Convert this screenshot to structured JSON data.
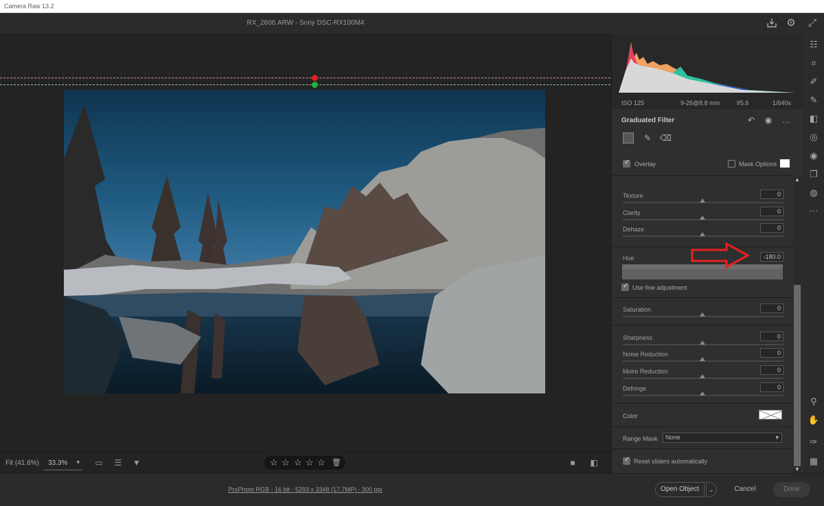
{
  "app": {
    "title": "Camera Raw 13.2"
  },
  "file": {
    "name": "RX_2606.ARW  -  Sony DSC-RX100M4"
  },
  "camera_info": {
    "iso": "ISO 125",
    "lens": "9-26@8.8 mm",
    "aperture": "f/5.6",
    "shutter": "1/640s"
  },
  "panel": {
    "title": "Graduated Filter",
    "overlay_label": "Overlay",
    "overlay_checked": true,
    "mask_options_label": "Mask Options",
    "use_fine_label": "Use fine adjustment",
    "use_fine_checked": true,
    "sliders": [
      {
        "label": "Texture",
        "value": "0"
      },
      {
        "label": "Clarity",
        "value": "0"
      },
      {
        "label": "Dehaze",
        "value": "0"
      },
      {
        "label": "Hue",
        "value": "-180.0"
      },
      {
        "label": "Saturation",
        "value": "0"
      },
      {
        "label": "Sharpness",
        "value": "0"
      },
      {
        "label": "Noise Reduction",
        "value": "0"
      },
      {
        "label": "Moire Reduction",
        "value": "0"
      },
      {
        "label": "Defringe",
        "value": "0"
      }
    ],
    "color_label": "Color",
    "range_mask_label": "Range Mask",
    "range_mask_value": "None",
    "reset_label": "Reset sliders automatically",
    "reset_checked": true
  },
  "bottom": {
    "fit_label": "Fit (41.6%)",
    "zoom_value": "33.3%",
    "rating_stars": 5,
    "star_glyph": "☆"
  },
  "footer": {
    "workflow": "ProPhoto RGB - 16 bit - 5293 x 3348 (17.7MP) - 300 ppi",
    "open_object": "Open Object",
    "cancel": "Cancel",
    "done": "Done"
  },
  "colors": {
    "annotation_arrow": "#e82020",
    "panel_bg": "#2f2f2f",
    "guide_red": "#e02020",
    "guide_green": "#20b040"
  },
  "icons": {
    "save": "save-icon",
    "settings": "gear-icon",
    "fullscreen": "expand-icon",
    "edit": "sliders-icon",
    "crop": "crop-icon",
    "heal": "healing-icon",
    "brush": "brush-icon",
    "graduated": "graduated-filter-icon",
    "radial": "radial-filter-icon",
    "redeye": "redeye-icon",
    "snapshots": "snapshots-icon",
    "presets": "presets-icon",
    "more": "more-icon",
    "zoom": "zoom-icon",
    "hand": "hand-icon",
    "sampler": "color-sampler-icon",
    "grid": "grid-icon"
  }
}
